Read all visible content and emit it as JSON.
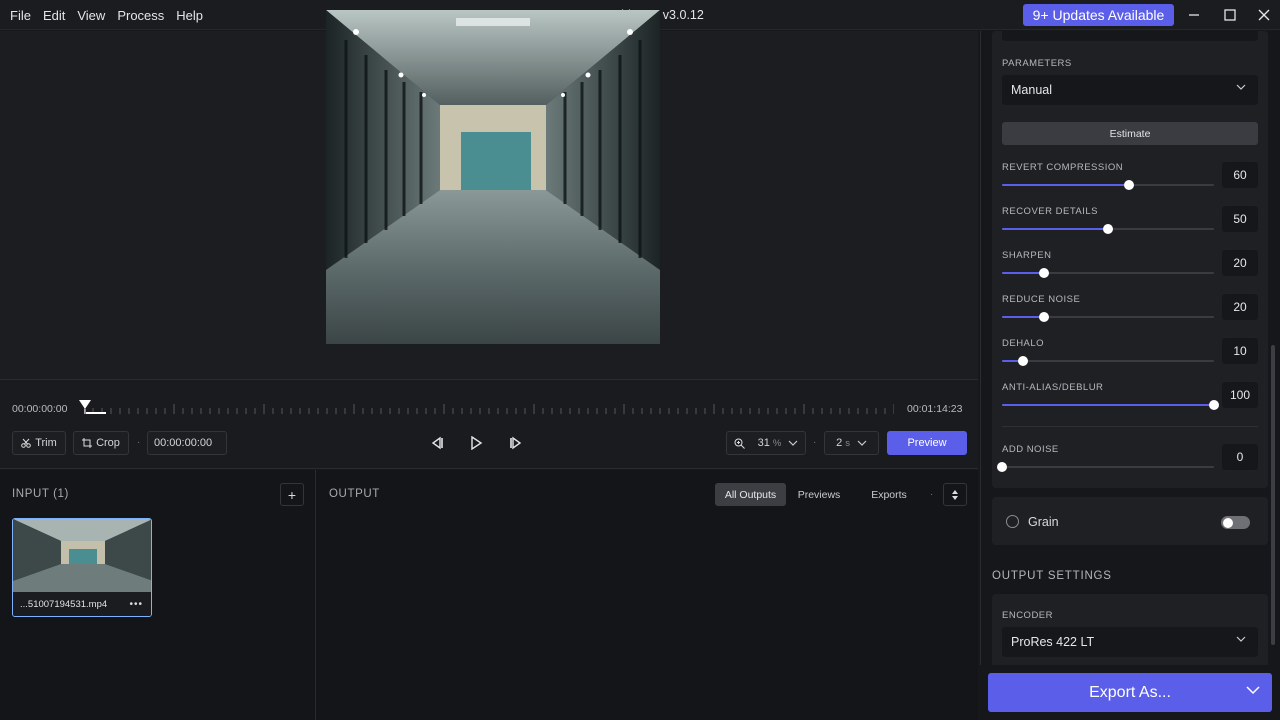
{
  "menu": [
    "File",
    "Edit",
    "View",
    "Process",
    "Help"
  ],
  "app_title": "Topaz Video AI  v3.0.12",
  "updates_label": "9+ Updates Available",
  "timeline": {
    "start_time": "00:00:00:00",
    "end_time": "00:01:14:23",
    "trim_label": "Trim",
    "crop_label": "Crop",
    "current_time": "00:00:00:00",
    "zoom_value": "31",
    "zoom_unit": "%",
    "preview_len": "2",
    "preview_len_unit": "s",
    "preview_label": "Preview"
  },
  "input": {
    "title": "INPUT (1)",
    "file_name": "...51007194531.mp4",
    "more": "•••"
  },
  "output": {
    "title": "OUTPUT",
    "tabs": [
      "All Outputs",
      "Previews",
      "Exports"
    ],
    "active_tab": "All Outputs"
  },
  "settings": {
    "parameters_label": "PARAMETERS",
    "parameters_value": "Manual",
    "estimate_label": "Estimate",
    "sliders": [
      {
        "label": "REVERT COMPRESSION",
        "value": 60,
        "fraction": 0.6
      },
      {
        "label": "RECOVER DETAILS",
        "value": 50,
        "fraction": 0.5
      },
      {
        "label": "SHARPEN",
        "value": 20,
        "fraction": 0.2
      },
      {
        "label": "REDUCE NOISE",
        "value": 20,
        "fraction": 0.2
      },
      {
        "label": "DEHALO",
        "value": 10,
        "fraction": 0.1
      },
      {
        "label": "ANTI-ALIAS/DEBLUR",
        "value": 100,
        "fraction": 1.0
      },
      {
        "label": "ADD NOISE",
        "value": 0,
        "fraction": 0.0
      }
    ],
    "grain_label": "Grain",
    "grain_enabled": false
  },
  "output_settings": {
    "title": "OUTPUT SETTINGS",
    "encoder_label": "ENCODER",
    "encoder_value": "ProRes 422 LT"
  },
  "export_label": "Export As...",
  "colors": {
    "accent": "#5b5ee8",
    "selection": "#7fb1ff"
  }
}
